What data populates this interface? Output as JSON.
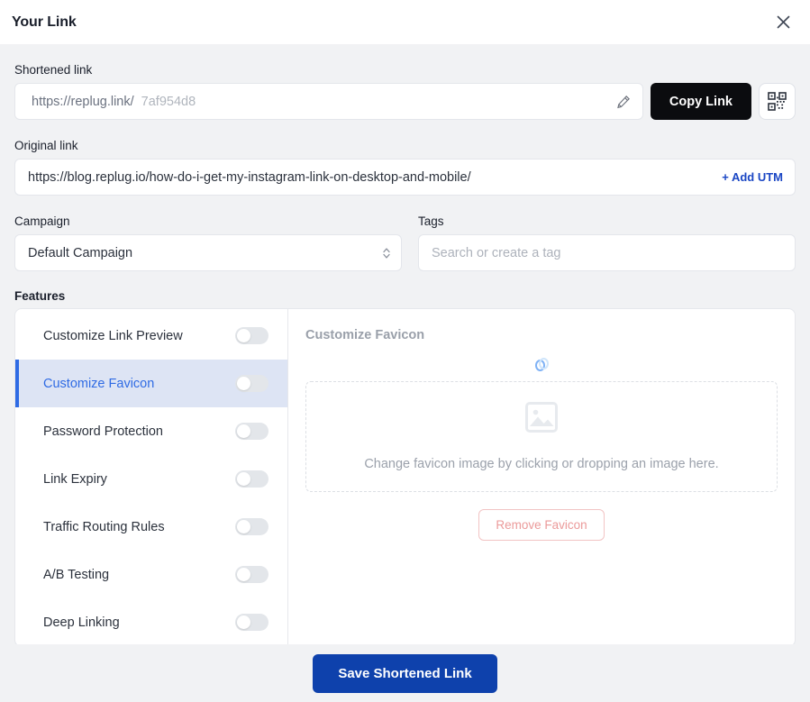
{
  "header": {
    "title": "Your Link",
    "close_icon": "close-icon"
  },
  "shortened_link": {
    "label": "Shortened link",
    "prefix": "https://replug.link/",
    "slug_placeholder": "7af954d8",
    "slug_value": "",
    "edit_icon": "pencil-icon",
    "copy_label": "Copy Link",
    "qr_icon": "qr-code-icon"
  },
  "original_link": {
    "label": "Original link",
    "value": "https://blog.replug.io/how-do-i-get-my-instagram-link-on-desktop-and-mobile/",
    "add_utm_label": "+ Add UTM"
  },
  "campaign": {
    "label": "Campaign",
    "selected": "Default Campaign",
    "options": [
      "Default Campaign"
    ]
  },
  "tags": {
    "label": "Tags",
    "placeholder": "Search or create a tag",
    "value": ""
  },
  "features": {
    "label": "Features",
    "items": [
      {
        "label": "Customize Link Preview",
        "enabled": false,
        "active": false
      },
      {
        "label": "Customize Favicon",
        "enabled": false,
        "active": true
      },
      {
        "label": "Password Protection",
        "enabled": false,
        "active": false
      },
      {
        "label": "Link Expiry",
        "enabled": false,
        "active": false
      },
      {
        "label": "Traffic Routing Rules",
        "enabled": false,
        "active": false
      },
      {
        "label": "A/B Testing",
        "enabled": false,
        "active": false
      },
      {
        "label": "Deep Linking",
        "enabled": false,
        "active": false
      }
    ]
  },
  "favicon_panel": {
    "title": "Customize Favicon",
    "loading_icon": "loading-spinner-icon",
    "dropzone_icon": "image-placeholder-icon",
    "dropzone_text": "Change favicon image by clicking or dropping an image here.",
    "remove_label": "Remove Favicon"
  },
  "footer": {
    "save_label": "Save Shortened Link"
  },
  "colors": {
    "accent_blue": "#2f6be4",
    "save_blue": "#0e41ac",
    "link_blue": "#1a46c4",
    "danger_soft": "#eb9a9a",
    "page_bg": "#f1f2f4"
  }
}
